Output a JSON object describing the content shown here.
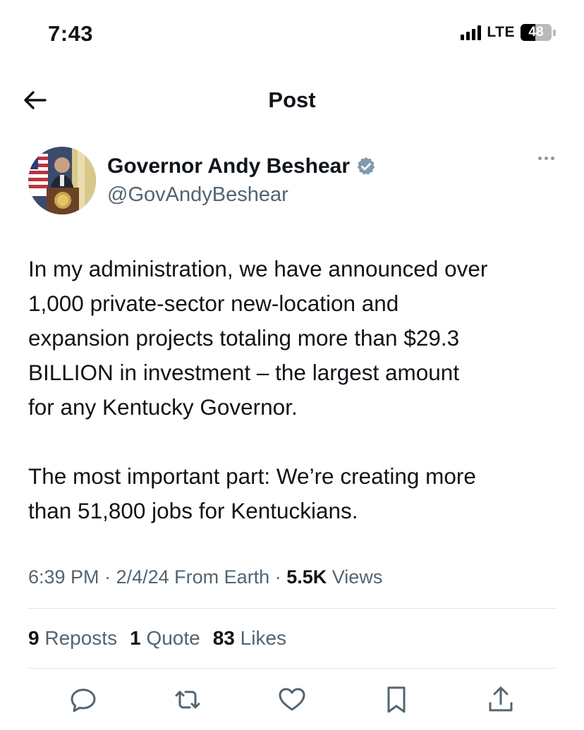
{
  "status_bar": {
    "time": "7:43",
    "network": "LTE",
    "battery": "48",
    "battery_level": 0.48
  },
  "nav": {
    "title": "Post",
    "back_icon": "arrow-left-icon"
  },
  "author": {
    "display_name": "Governor Andy Beshear",
    "handle": "@GovAndyBeshear",
    "verified_color": "#829aab"
  },
  "post": {
    "text": "In my administration, we have announced over\n1,000 private-sector new-location and\nexpansion projects totaling more than $29.3\nBILLION in investment – the largest amount\nfor any Kentucky Governor.\n\nThe most important part: We’re creating more\nthan 51,800 jobs for Kentuckians.",
    "time": "6:39 PM",
    "date": "2/4/24",
    "source": "From Earth",
    "views_count": "5.5K",
    "views_label": "Views"
  },
  "stats": {
    "reposts_count": "9",
    "reposts_label": "Reposts",
    "quotes_count": "1",
    "quotes_label": "Quote",
    "likes_count": "83",
    "likes_label": "Likes"
  },
  "actions": [
    "reply-icon",
    "repost-icon",
    "like-icon",
    "bookmark-icon",
    "share-icon"
  ],
  "colors": {
    "text": "#0f1419",
    "secondary": "#536471",
    "icon": "#536471"
  }
}
